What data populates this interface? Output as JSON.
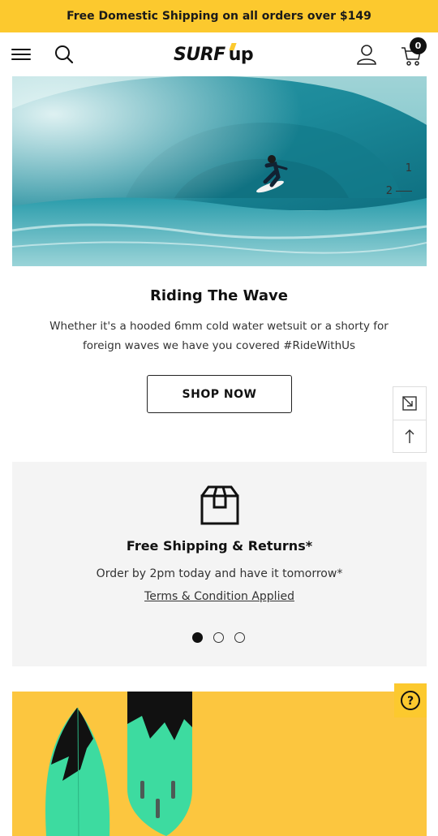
{
  "announcement": {
    "text": "Free Domestic Shipping on all orders over $149"
  },
  "header": {
    "logo": {
      "word1": "SURF",
      "word2": "up"
    },
    "cart_count": "0"
  },
  "hero": {
    "slide_numbers": [
      "1",
      "2"
    ],
    "title": "Riding The Wave",
    "description": "Whether it's a hooded 6mm cold water wetsuit or a shorty for foreign waves we have you covered #RideWithUs",
    "cta_label": "SHOP NOW"
  },
  "features": {
    "title": "Free Shipping & Returns*",
    "text": "Order by 2pm today and have it tomorrow*",
    "link": "Terms & Condition Applied",
    "active_dot": 0,
    "dot_count": 3
  },
  "help": {
    "label": "?"
  },
  "colors": {
    "accent": "#fcc92e",
    "promo_bg": "#fcc63f",
    "board_green": "#3ddba0"
  }
}
